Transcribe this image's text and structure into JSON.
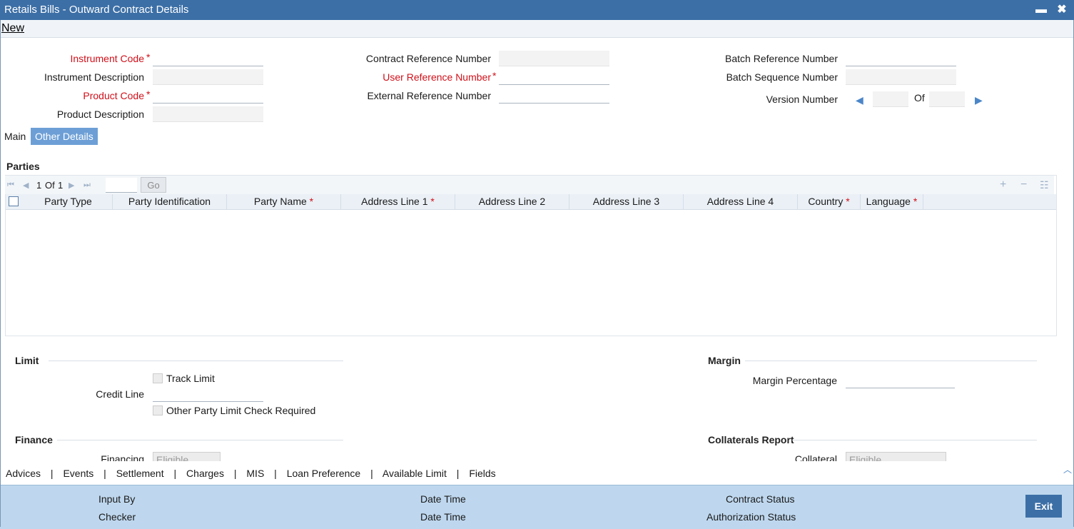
{
  "window": {
    "title": "Retails Bills - Outward Contract Details",
    "minimize": "▬",
    "close": "✖"
  },
  "menu": {
    "new": "New"
  },
  "fields": {
    "instrument_code": "Instrument Code",
    "instrument_description": "Instrument Description",
    "product_code": "Product Code",
    "product_description": "Product Description",
    "contract_reference_number": "Contract Reference Number",
    "user_reference_number": "User Reference Number",
    "external_reference_number": "External Reference Number",
    "batch_reference_number": "Batch Reference Number",
    "batch_sequence_number": "Batch Sequence Number",
    "version_number": "Version Number",
    "version_of": "Of",
    "required_mark": "*"
  },
  "tabs": {
    "main": "Main",
    "other_details": "Other Details"
  },
  "parties": {
    "section_title": "Parties",
    "pager": {
      "current": "1",
      "of": "Of",
      "total": "1",
      "go": "Go"
    },
    "columns": [
      "Party Type",
      "Party Identification",
      "Party Name",
      "Address Line 1",
      "Address Line 2",
      "Address Line 3",
      "Address Line 4",
      "Country",
      "Language"
    ],
    "rows": []
  },
  "limit": {
    "section_title": "Limit",
    "track_limit": "Track Limit",
    "credit_line": "Credit Line",
    "other_party_limit": "Other Party Limit Check Required"
  },
  "margin": {
    "section_title": "Margin",
    "margin_percentage": "Margin Percentage"
  },
  "finance": {
    "section_title": "Finance",
    "financing": "Financing",
    "financing_value": "Eligible"
  },
  "collaterals": {
    "section_title": "Collaterals Report",
    "collateral": "Collateral",
    "collateral_value": "Eligible"
  },
  "subsystems": [
    "Advices",
    "Events",
    "Settlement",
    "Charges",
    "MIS",
    "Loan Preference",
    "Available Limit",
    "Fields"
  ],
  "separator": "|",
  "footer": {
    "input_by": "Input By",
    "checker": "Checker",
    "date_time_1": "Date Time",
    "date_time_2": "Date Time",
    "contract_status": "Contract Status",
    "authorization_status": "Authorization Status",
    "exit": "Exit"
  },
  "colors": {
    "titlebar": "#3c6fa6",
    "tab_active": "#6d9fd6",
    "required": "#d0101a",
    "footer": "#bed7ee"
  }
}
